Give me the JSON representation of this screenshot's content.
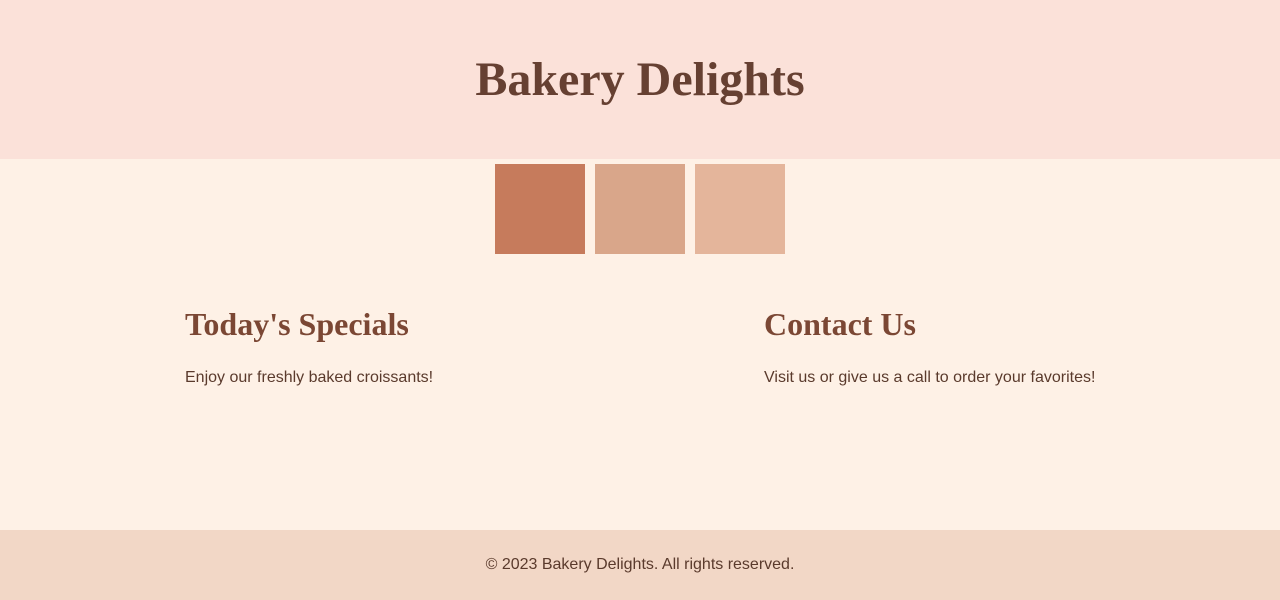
{
  "header": {
    "title": "Bakery Delights"
  },
  "gallery": {
    "swatches": [
      {
        "icon": "pastry-image",
        "color": "#c67b5c"
      },
      {
        "icon": "pastry-image",
        "color": "#d9a68a"
      },
      {
        "icon": "pastry-image",
        "color": "#e4b59b"
      }
    ]
  },
  "specials": {
    "heading": "Today's Specials",
    "text": "Enjoy our freshly baked croissants!"
  },
  "contact": {
    "heading": "Contact Us",
    "text": "Visit us or give us a call to order your favorites!"
  },
  "footer": {
    "text": "© 2023 Bakery Delights. All rights reserved."
  },
  "colors": {
    "header_bg": "#fbe1d9",
    "page_bg": "#fef1e6",
    "footer_bg": "#f2d7c6",
    "title": "#664032",
    "heading": "#7b4734",
    "body_text": "#5a3a2c"
  }
}
